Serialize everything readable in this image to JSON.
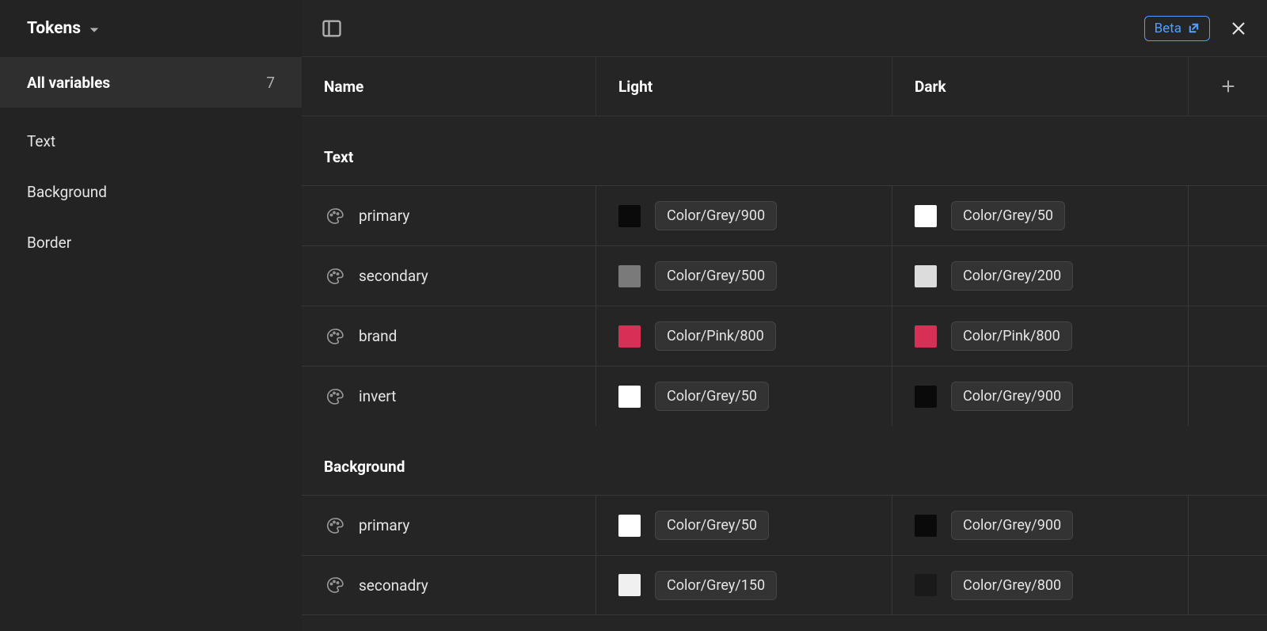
{
  "sidebar": {
    "title": "Tokens",
    "items": [
      {
        "label": "All variables",
        "count": "7",
        "selected": true
      },
      {
        "label": "Text"
      },
      {
        "label": "Background"
      },
      {
        "label": "Border"
      }
    ]
  },
  "header": {
    "beta_label": "Beta",
    "columns": {
      "name": "Name",
      "modes": [
        "Light",
        "Dark"
      ]
    }
  },
  "groups": [
    {
      "name": "Text",
      "variables": [
        {
          "name": "primary",
          "modes": [
            {
              "swatch": "#0a0a0a",
              "token": "Color/Grey/900"
            },
            {
              "swatch": "#ffffff",
              "token": "Color/Grey/50"
            }
          ]
        },
        {
          "name": "secondary",
          "modes": [
            {
              "swatch": "#7a7a7a",
              "token": "Color/Grey/500"
            },
            {
              "swatch": "#dcdcdc",
              "token": "Color/Grey/200"
            }
          ]
        },
        {
          "name": "brand",
          "modes": [
            {
              "swatch": "#d72f55",
              "token": "Color/Pink/800"
            },
            {
              "swatch": "#d72f55",
              "token": "Color/Pink/800"
            }
          ]
        },
        {
          "name": "invert",
          "modes": [
            {
              "swatch": "#ffffff",
              "token": "Color/Grey/50"
            },
            {
              "swatch": "#0a0a0a",
              "token": "Color/Grey/900"
            }
          ]
        }
      ]
    },
    {
      "name": "Background",
      "variables": [
        {
          "name": "primary",
          "modes": [
            {
              "swatch": "#ffffff",
              "token": "Color/Grey/50"
            },
            {
              "swatch": "#0a0a0a",
              "token": "Color/Grey/900"
            }
          ]
        },
        {
          "name": "seconadry",
          "modes": [
            {
              "swatch": "#f0f0f0",
              "token": "Color/Grey/150"
            },
            {
              "swatch": "#1a1a1a",
              "token": "Color/Grey/800"
            }
          ]
        }
      ]
    }
  ]
}
